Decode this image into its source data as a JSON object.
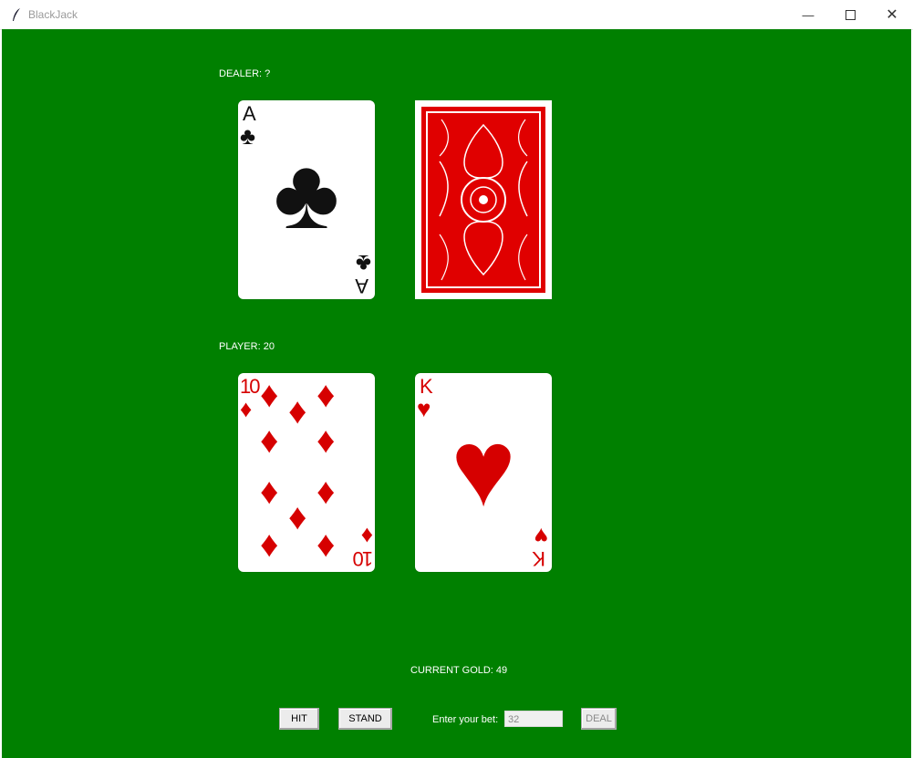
{
  "window": {
    "title": "BlackJack",
    "minimize_icon": "minimize-icon",
    "maximize_icon": "maximize-icon",
    "close_icon": "close-icon"
  },
  "dealer": {
    "label": "DEALER: ?",
    "cards": [
      {
        "rank": "A",
        "suit": "♣",
        "color": "#111111",
        "face_up": true
      },
      {
        "face_up": false,
        "back_color": "#e00000"
      }
    ]
  },
  "player": {
    "label": "PLAYER: 20",
    "cards": [
      {
        "rank": "10",
        "suit": "♦",
        "color": "#d60000",
        "face_up": true
      },
      {
        "rank": "K",
        "suit": "♥",
        "color": "#d60000",
        "face_up": true
      }
    ]
  },
  "gold": {
    "label": "CURRENT GOLD: 49"
  },
  "controls": {
    "hit_label": "HIT",
    "stand_label": "STAND",
    "bet_prompt": "Enter your bet:",
    "bet_value": "32",
    "deal_label": "DEAL"
  },
  "colors": {
    "felt": "#008000",
    "card_red": "#d60000",
    "card_back": "#e00000"
  }
}
